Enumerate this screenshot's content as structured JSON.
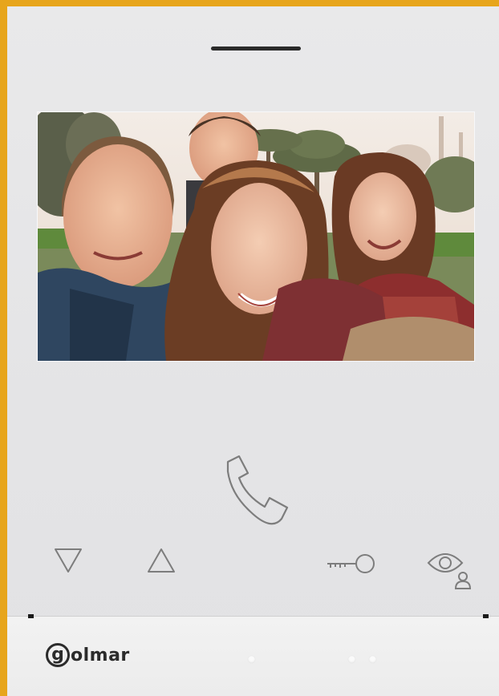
{
  "brand": {
    "logo_mark": "g",
    "logo_text": "olmar"
  },
  "colors": {
    "frame_accent": "#e7a51c",
    "device_body": "#e6e6e8",
    "icon_stroke": "#7d7d7d",
    "logo": "#2b2b2b"
  },
  "screen": {
    "content": "video-feed"
  },
  "controls": [
    {
      "id": "down",
      "icon": "triangle-down-icon"
    },
    {
      "id": "up",
      "icon": "triangle-up-icon"
    },
    {
      "id": "call",
      "icon": "handset-icon"
    },
    {
      "id": "door",
      "icon": "key-icon"
    },
    {
      "id": "view",
      "icon": "eye-user-icon"
    }
  ]
}
